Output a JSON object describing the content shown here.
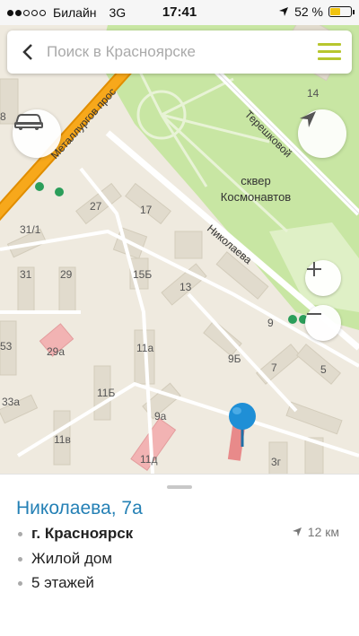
{
  "status_bar": {
    "carrier": "Билайн",
    "network": "3G",
    "time": "17:41",
    "battery": "52 %",
    "battery_level": 0.52,
    "signal_bars_filled": 2,
    "signal_bars_total": 5
  },
  "search": {
    "placeholder": "Поиск в Красноярске",
    "value": ""
  },
  "map": {
    "street_labels": {
      "metallurgov": "Металлургов прос",
      "tereshkovoy": "Терешковой",
      "nikolaeva": "Николаева"
    },
    "park_label_line1": "сквер",
    "park_label_line2": "Космонавтов",
    "house_numbers": {
      "h14": "14",
      "h8": "8",
      "h27": "27",
      "h17": "17",
      "h31_1": "31/1",
      "h31": "31",
      "h29": "29",
      "h15b": "15Б",
      "h13": "13",
      "h9": "9",
      "h53": "53",
      "h29a": "29а",
      "h11a": "11а",
      "h9b": "9Б",
      "h7": "7",
      "h5": "5",
      "h33a": "33а",
      "h11b": "11Б",
      "h9a": "9а",
      "h11v": "11в",
      "h11d": "11д",
      "h3g": "3г"
    },
    "colors": {
      "ground": "#efeadf",
      "park": "#c8e6a3",
      "road_major": "#f7a81b",
      "accent": "#b7c62e",
      "pin": "#1f8fd6"
    }
  },
  "card": {
    "title": "Николаева, 7а",
    "city": "г. Красноярск",
    "type": "Жилой дом",
    "floors": "5 этажей",
    "distance": "12 км"
  }
}
